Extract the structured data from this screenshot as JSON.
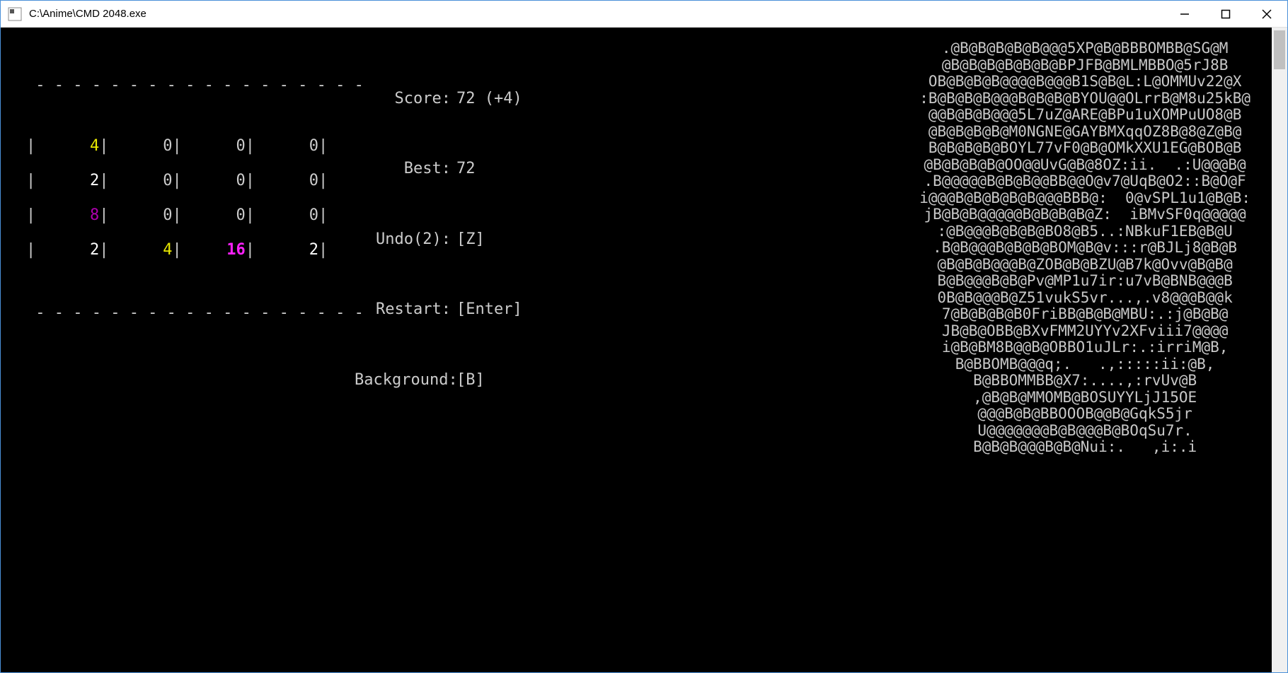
{
  "window": {
    "title": "C:\\Anime\\CMD 2048.exe"
  },
  "board": {
    "dash_line": " - - - - - - - - - - - - - - - - - - ",
    "cells": [
      [
        4,
        0,
        0,
        0
      ],
      [
        2,
        0,
        0,
        0
      ],
      [
        8,
        0,
        0,
        0
      ],
      [
        2,
        4,
        16,
        2
      ]
    ]
  },
  "stats": {
    "score_label": "Score:",
    "score_value": "72 (+4)",
    "best_label": "Best:",
    "best_value": "72",
    "undo_label": "Undo(2):",
    "undo_value": "[Z]",
    "restart_label": "Restart:",
    "restart_value": "[Enter]",
    "background_label": "Background:",
    "background_value": "[B]"
  },
  "ascii_art": [
    ".@B@B@B@B@B@@@5XP@B@BBBOMBB@SG@M",
    "@B@B@B@B@B@B@BPJFB@BMLMBBO@5rJ8B",
    "OB@B@B@B@@@@B@@@B1S@B@L:L@OMMUv22@X",
    ":B@B@B@B@@@B@B@B@BYOU@@OLrrB@M8u25kB@",
    "@@B@B@B@@@5L7uZ@ARE@BPu1uXOMPuUO8@B",
    "@B@B@B@B@M0NGNE@GAYBMXqqOZ8B@8@Z@B@",
    "B@B@B@B@BOYL77vF0@B@OMkXXU1EG@BOB@B",
    "@B@B@B@B@OO@@UvG@B@8OZ:ii.  .:U@@@B@",
    ".B@@@@@B@B@B@@BB@@O@v7@UqB@O2::B@O@F",
    "i@@@B@B@B@B@B@@@BBB@:  0@vSPL1u1@B@B:",
    "jB@B@B@@@@@B@B@B@B@Z:  iBMvSF0q@@@@@",
    ":@B@@@B@B@B@BO8@B5..:NBkuF1EB@B@U",
    ".B@B@@@B@B@B@BOM@B@v:::r@BJLj8@B@B",
    "@B@B@B@@@B@ZOB@B@BZU@B7k@Ovv@B@B@",
    "B@B@@@B@B@Pv@MP1u7ir:u7vB@BNB@@@B",
    "0B@B@@@B@Z51vukS5vr...,.v8@@@B@@k",
    "7@B@B@B@B0FriBB@B@B@MBU:.:j@B@B@",
    "JB@B@OBB@BXvFMM2UYYv2XFviii7@@@@",
    "i@B@BM8B@@B@OBBO1uJLr:.:irriM@B,",
    "B@BBOMB@@@q;.   .,:::::ii:@B,",
    "B@BBOMMBB@X7:....,:rvUv@B",
    ",@B@B@MMOMB@BOSUYYLjJ15OE",
    "@@@B@B@BBOOOB@@B@GqkS5jr",
    "U@@@@@@@B@B@@@B@BOqSu7r.",
    "B@B@B@@@B@B@Nui:.   ,i:.i"
  ]
}
